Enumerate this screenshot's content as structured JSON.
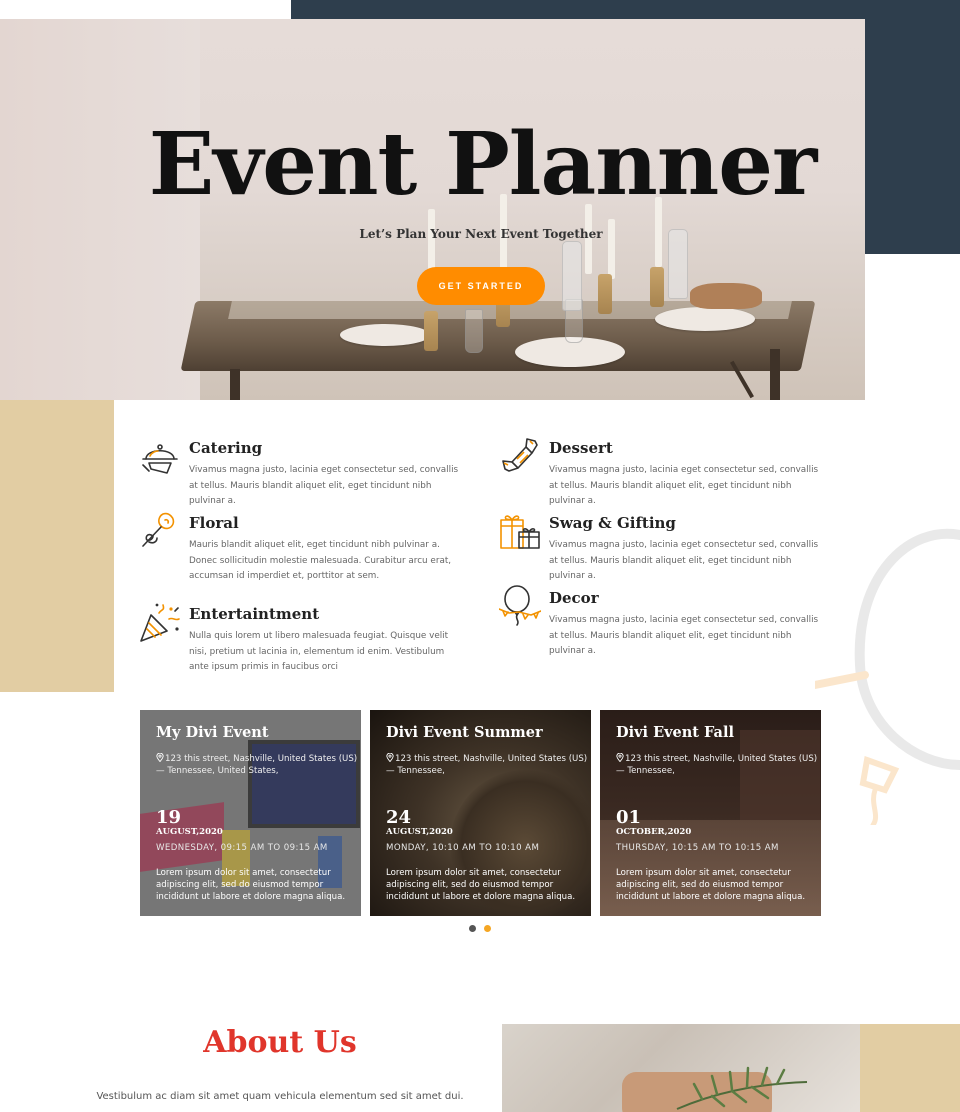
{
  "hero": {
    "title": "Event Planner",
    "subtitle": "Let’s Plan Your Next Event Together",
    "button_label": "GET STARTED"
  },
  "services": [
    {
      "title": "Catering",
      "icon": "cloche-icon",
      "description": "Vivamus magna justo, lacinia eget consectetur sed, convallis at tellus. Mauris blandit aliquet elit, eget tincidunt nibh pulvinar a."
    },
    {
      "title": "Dessert",
      "icon": "candy-icon",
      "description": "Vivamus magna justo, lacinia eget consectetur sed, convallis at tellus. Mauris blandit aliquet elit, eget tincidunt nibh pulvinar a."
    },
    {
      "title": "Floral",
      "icon": "rose-icon",
      "description": "Mauris blandit aliquet elit, eget tincidunt nibh pulvinar a. Donec sollicitudin molestie malesuada. Curabitur arcu erat, accumsan id imperdiet et, porttitor at sem."
    },
    {
      "title": "Swag & Gifting",
      "icon": "gift-icon",
      "description": "Vivamus magna justo, lacinia eget consectetur sed, convallis at tellus. Mauris blandit aliquet elit, eget tincidunt nibh pulvinar a."
    },
    {
      "title": "Entertaintment",
      "icon": "party-popper-icon",
      "description": "Nulla quis lorem ut libero malesuada feugiat. Quisque velit nisi, pretium ut lacinia in, elementum id enim. Vestibulum ante ipsum primis in faucibus orci"
    },
    {
      "title": "Decor",
      "icon": "balloon-icon",
      "description": "Vivamus magna justo, lacinia eget consectetur sed, convallis at tellus. Mauris blandit aliquet elit, eget tincidunt nibh pulvinar a."
    }
  ],
  "events": [
    {
      "title": "My Divi Event",
      "address": "123 this street, Nashville, United States (US) — Tennessee, United States,",
      "day": "19",
      "month_year": "AUGUST,2020",
      "time": "WEDNESDAY, 09:15 AM TO 09:15 AM",
      "description": "Lorem ipsum dolor sit amet, consectetur adipiscing elit, sed do eiusmod tempor incididunt ut labore et dolore magna aliqua."
    },
    {
      "title": "Divi Event Summer",
      "address": "123 this street, Nashville, United States (US) — Tennessee,",
      "day": "24",
      "month_year": "AUGUST,2020",
      "time": "MONDAY, 10:10 AM TO 10:10 AM",
      "description": "Lorem ipsum dolor sit amet, consectetur adipiscing elit, sed do eiusmod tempor incididunt ut labore et dolore magna aliqua."
    },
    {
      "title": "Divi Event Fall",
      "address": "123 this street, Nashville, United States (US) — Tennessee,",
      "day": "01",
      "month_year": "OCTOBER,2020",
      "time": "THURSDAY, 10:15 AM TO 10:15 AM",
      "description": "Lorem ipsum dolor sit amet, consectetur adipiscing elit, sed do eiusmod tempor incididunt ut labore et dolore magna aliqua."
    }
  ],
  "slider": {
    "active_index": 1,
    "count": 2
  },
  "about": {
    "title": "About Us",
    "text": "Vestibulum ac diam sit amet quam vehicula elementum sed sit amet dui."
  },
  "colors": {
    "accent_orange": "#ff8c00",
    "navy": "#2e3e4d",
    "beige": "#e2cda3",
    "about_red": "#e0352b",
    "dot_inactive": "#555555",
    "dot_active": "#f5a623"
  }
}
